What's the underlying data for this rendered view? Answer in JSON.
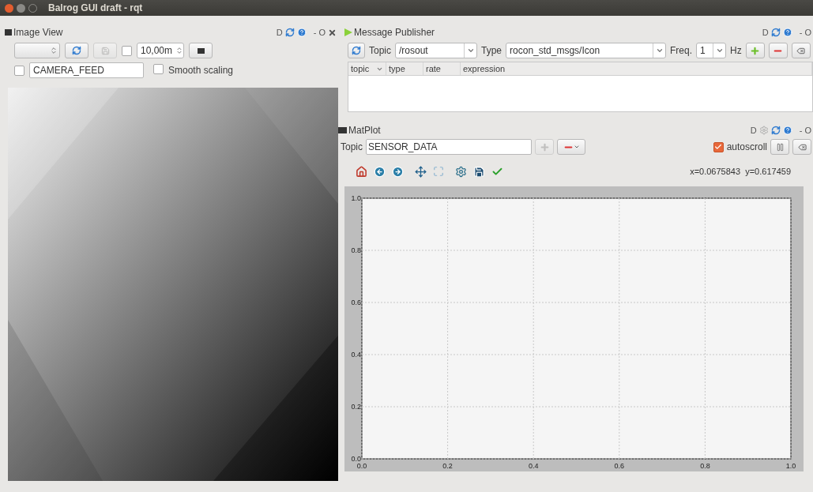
{
  "window": {
    "title": "Balrog GUI draft - rqt"
  },
  "image_view": {
    "title": "Image View",
    "dock_controls": [
      "D",
      "-",
      "O"
    ],
    "save_button": {
      "disabled": true
    },
    "zoom_checkbox": {
      "checked": false
    },
    "timeout": {
      "value": "10,00m"
    },
    "topic_checkbox": {
      "checked": false
    },
    "topic_field": {
      "value": "CAMERA_FEED"
    },
    "smooth_scaling": {
      "label": "Smooth scaling",
      "checked": false
    },
    "image": {
      "kind": "picture"
    }
  },
  "message_publisher": {
    "title": "Message Publisher",
    "dock_controls": [
      "D",
      "-",
      "O"
    ],
    "topic_label": "Topic",
    "topic": "/rosout",
    "type_label": "Type",
    "type": "rocon_std_msgs/Icon",
    "freq_label": "Freq.",
    "freq": "1",
    "hz_label": "Hz",
    "columns": [
      "topic",
      "type",
      "rate",
      "expression"
    ]
  },
  "matplot": {
    "title": "MatPlot",
    "dock_controls": [
      "D",
      "-",
      "O"
    ],
    "topic_label": "Topic",
    "topic": "SENSOR_DATA",
    "add_disabled": true,
    "autoscroll": {
      "label": "autoscroll",
      "checked": true
    },
    "coordinates": "x=0.0675843  y=0.617459",
    "chart_data": {
      "type": "line",
      "grid": true,
      "xlim": [
        0,
        1
      ],
      "ylim": [
        0,
        1
      ],
      "xticks": [
        {
          "value": 0,
          "label": "0.0"
        },
        {
          "value": 0.2,
          "label": "0.2"
        },
        {
          "value": 0.4,
          "label": "0.4"
        },
        {
          "value": 0.6,
          "label": "0.6"
        },
        {
          "value": 0.8,
          "label": "0.8"
        },
        {
          "value": 1,
          "label": "1.0"
        }
      ],
      "yticks": [
        {
          "value": 0,
          "label": "0.0"
        },
        {
          "value": 0.2,
          "label": "0.2"
        },
        {
          "value": 0.4,
          "label": "0.4"
        },
        {
          "value": 0.6,
          "label": "0.6"
        },
        {
          "value": 0.8,
          "label": "0.8"
        },
        {
          "value": 1,
          "label": "1.0"
        }
      ]
    }
  }
}
